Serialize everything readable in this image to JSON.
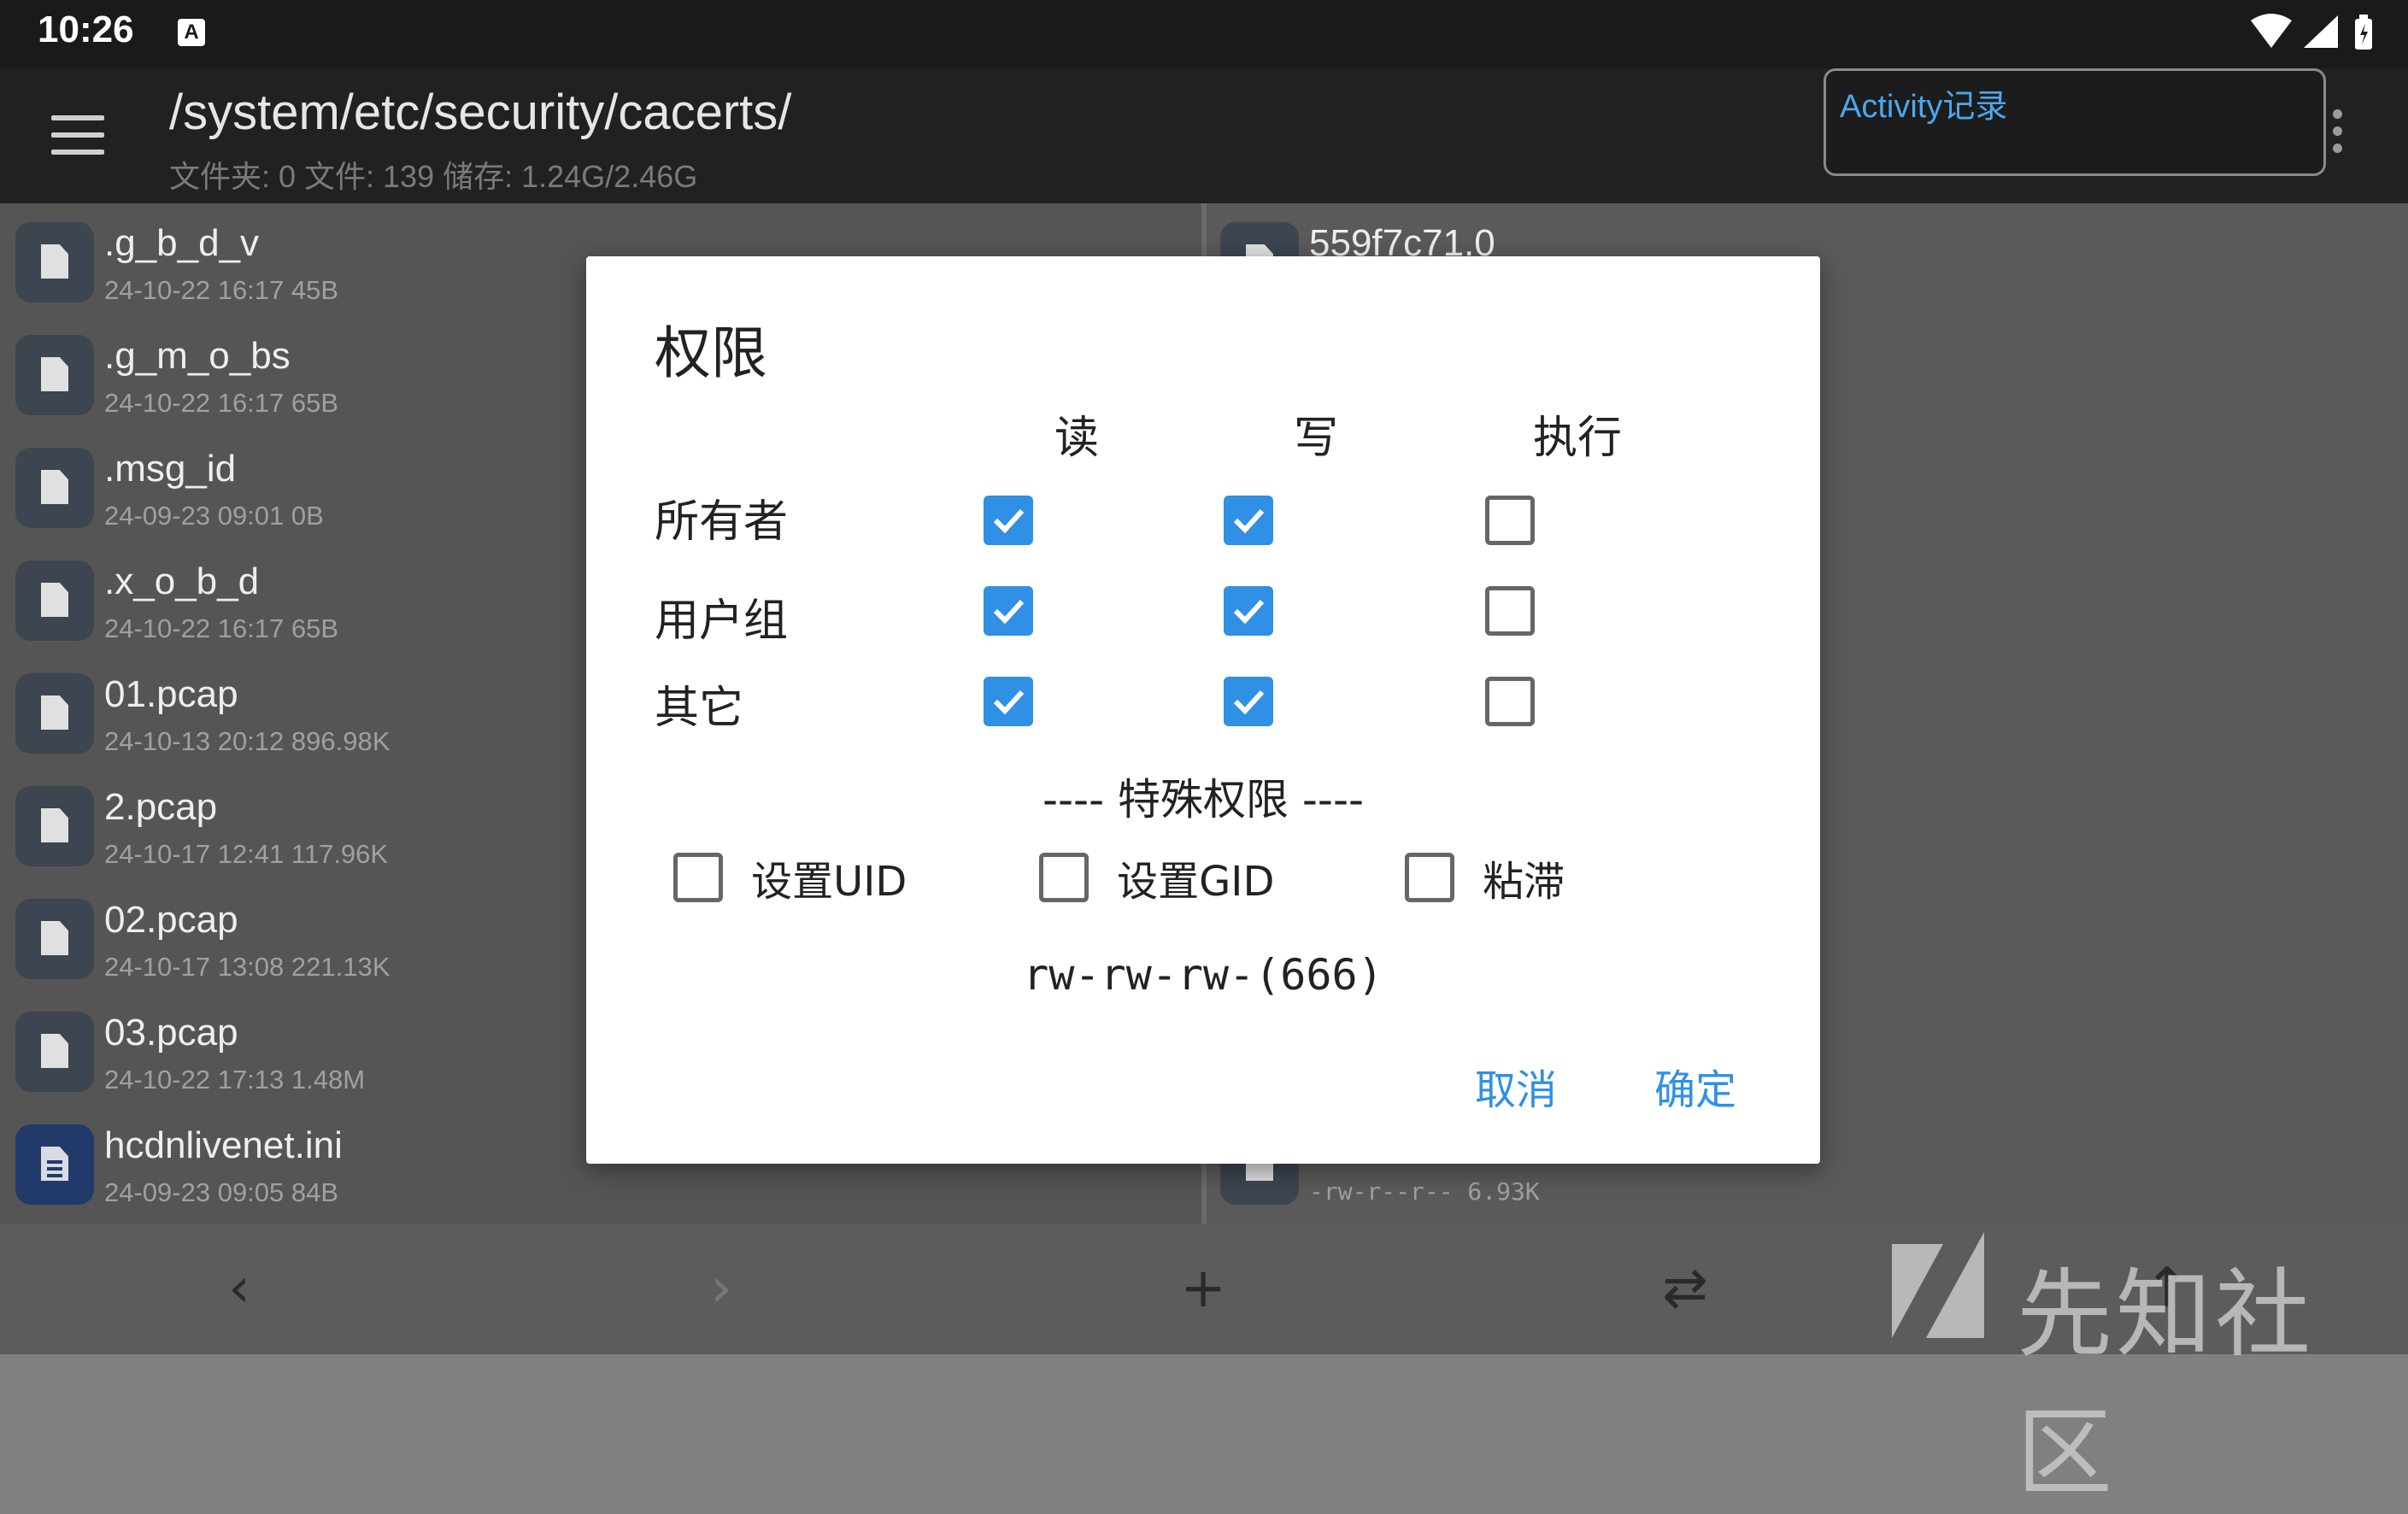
{
  "status_bar": {
    "time": "10:26",
    "notification_icon": "A"
  },
  "toolbar": {
    "path": "/system/etc/security/cacerts/",
    "stats": "文件夹: 0  文件: 139  储存: 1.24G/2.46G",
    "activity_label": "Activity记录"
  },
  "left_files": [
    {
      "name": ".g_b_d_v",
      "meta": "24-10-22 16:17  45B",
      "icon": "file-icon"
    },
    {
      "name": ".g_m_o_bs",
      "meta": "24-10-22 16:17  65B",
      "icon": "file-icon"
    },
    {
      "name": ".msg_id",
      "meta": "24-09-23 09:01  0B",
      "icon": "file-icon"
    },
    {
      "name": ".x_o_b_d",
      "meta": "24-10-22 16:17  65B",
      "icon": "file-icon"
    },
    {
      "name": "01.pcap",
      "meta": "24-10-13 20:12  896.98K",
      "icon": "file-icon"
    },
    {
      "name": "2.pcap",
      "meta": "24-10-17 12:41  117.96K",
      "icon": "file-icon"
    },
    {
      "name": "02.pcap",
      "meta": "24-10-17 13:08  221.13K",
      "icon": "file-icon"
    },
    {
      "name": "03.pcap",
      "meta": "24-10-22 17:13  1.48M",
      "icon": "file-icon"
    },
    {
      "name": "hcdnlivenet.ini",
      "meta": "24-09-23 09:05  84B",
      "icon": "text-file-icon"
    }
  ],
  "right_files": {
    "top_name": "559f7c71.0",
    "bottom_meta": "-rw-r--r--  6.93K"
  },
  "dialog": {
    "title": "权限",
    "columns": [
      "读",
      "写",
      "执行"
    ],
    "rows": [
      {
        "label": "所有者",
        "read": true,
        "write": true,
        "execute": false
      },
      {
        "label": "用户组",
        "read": true,
        "write": true,
        "execute": false
      },
      {
        "label": "其它",
        "read": true,
        "write": true,
        "execute": false
      }
    ],
    "special_title": "---- 特殊权限 ----",
    "special": [
      {
        "label": "设置UID",
        "checked": false
      },
      {
        "label": "设置GID",
        "checked": false
      },
      {
        "label": "粘滞",
        "checked": false
      }
    ],
    "permission_string": "rw-rw-rw-(666)",
    "cancel_label": "取消",
    "ok_label": "确定"
  },
  "bottom_bar": {
    "back_glyph": "‹",
    "forward_glyph": "›",
    "add_glyph": "+",
    "swap_glyph": "⇄"
  },
  "watermark": {
    "text": "先知社区"
  },
  "colors": {
    "accent": "#2f90e5",
    "dialog_bg": "#ffffff",
    "toolbar_bg": "#212121"
  }
}
